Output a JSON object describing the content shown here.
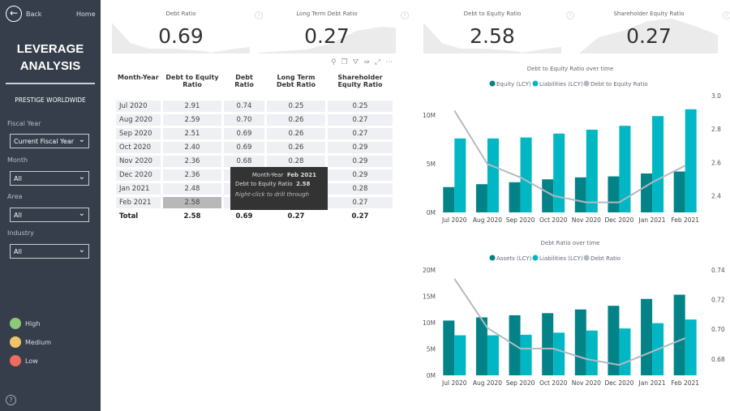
{
  "sidebar": {
    "back": "Back",
    "home": "Home",
    "title_line1": "LEVERAGE",
    "title_line2": "ANALYSIS",
    "company": "PRESTIGE WORLDWIDE",
    "filters": [
      {
        "label": "Fiscal Year",
        "value": "Current Fiscal Year"
      },
      {
        "label": "Month",
        "value": "All"
      },
      {
        "label": "Area",
        "value": "All"
      },
      {
        "label": "Industry",
        "value": "All"
      }
    ],
    "legend": [
      {
        "label": "High",
        "color": "#8cc97a"
      },
      {
        "label": "Medium",
        "color": "#f2c26b"
      },
      {
        "label": "Low",
        "color": "#ee6b5e"
      }
    ],
    "help": "?"
  },
  "kpis": [
    {
      "title": "Debt Ratio",
      "value": "0.69"
    },
    {
      "title": "Long Term Debt Ratio",
      "value": "0.27"
    },
    {
      "title": "Debt to Equity Ratio",
      "value": "2.58"
    },
    {
      "title": "Shareholder Equity Ratio",
      "value": "0.27"
    }
  ],
  "table": {
    "headers": [
      "Month-Year",
      "Debt to Equity Ratio",
      "Debt Ratio",
      "Long Term Debt Ratio",
      "Shareholder Equity Ratio"
    ],
    "rows": [
      [
        "Jul 2020",
        "2.91",
        "0.74",
        "0.25",
        "0.25"
      ],
      [
        "Aug 2020",
        "2.59",
        "0.70",
        "0.26",
        "0.27"
      ],
      [
        "Sep 2020",
        "2.51",
        "0.69",
        "0.26",
        "0.27"
      ],
      [
        "Oct 2020",
        "2.40",
        "0.69",
        "0.26",
        "0.29"
      ],
      [
        "Nov 2020",
        "2.36",
        "0.68",
        "0.28",
        "0.29"
      ],
      [
        "Dec 2020",
        "2.36",
        "",
        "",
        "0.29"
      ],
      [
        "Jan 2021",
        "2.48",
        "",
        "",
        "0.28"
      ],
      [
        "Feb 2021",
        "2.58",
        "",
        "",
        "0.27"
      ]
    ],
    "total": [
      "Total",
      "2.58",
      "0.69",
      "0.27",
      "0.27"
    ]
  },
  "tooltip": {
    "k1": "Month-Year",
    "v1": "Feb 2021",
    "k2": "Debt to Equity Ratio",
    "v2": "2.58",
    "hint": "Right-click to drill through"
  },
  "chart_data": [
    {
      "type": "bar",
      "title": "Debt to Equity Ratio over time",
      "categories": [
        "Jul 2020",
        "Aug 2020",
        "Sep 2020",
        "Oct 2020",
        "Nov 2020",
        "Dec 2020",
        "Jan 2021",
        "Feb 2021"
      ],
      "series": [
        {
          "name": "Equity (LCY)",
          "values": [
            2.6,
            2.9,
            3.1,
            3.4,
            3.6,
            3.7,
            4.0,
            4.2
          ],
          "color": "#038387"
        },
        {
          "name": "Liabilities (LCY)",
          "values": [
            7.6,
            7.6,
            7.7,
            8.1,
            8.5,
            8.9,
            9.9,
            10.6
          ],
          "color": "#00b7c3"
        },
        {
          "name": "Debt to Equity Ratio",
          "type": "line",
          "axis": "right",
          "values": [
            2.91,
            2.59,
            2.51,
            2.4,
            2.36,
            2.36,
            2.48,
            2.58
          ],
          "color": "#b3b9c4"
        }
      ],
      "ylim": [
        0,
        12
      ],
      "yticks": [
        "0M",
        "5M",
        "10M"
      ],
      "yticks_values": [
        0,
        5,
        10
      ],
      "y2lim": [
        2.3,
        3.0
      ],
      "y2ticks": [
        "2.4",
        "2.6",
        "2.8",
        "3.0"
      ],
      "y2ticks_values": [
        2.4,
        2.6,
        2.8,
        3.0
      ],
      "legend": "top"
    },
    {
      "type": "bar",
      "title": "Debt Ratio over time",
      "categories": [
        "Jul 2020",
        "Aug 2020",
        "Sep 2020",
        "Oct 2020",
        "Nov 2020",
        "Dec 2020",
        "Jan 2021",
        "Feb 2021"
      ],
      "series": [
        {
          "name": "Assets (LCY)",
          "values": [
            10.4,
            11.0,
            11.4,
            11.8,
            12.5,
            13.2,
            14.5,
            15.3
          ],
          "color": "#038387"
        },
        {
          "name": "Liabilities (LCY)",
          "values": [
            7.6,
            7.6,
            7.7,
            8.1,
            8.5,
            8.9,
            9.9,
            10.6
          ],
          "color": "#00b7c3"
        },
        {
          "name": "Debt Ratio",
          "type": "line",
          "axis": "right",
          "values": [
            0.734,
            0.701,
            0.687,
            0.687,
            0.68,
            0.676,
            0.685,
            0.694
          ],
          "color": "#b3b9c4"
        }
      ],
      "ylim": [
        0,
        20
      ],
      "yticks": [
        "0M",
        "5M",
        "10M",
        "15M",
        "20M"
      ],
      "yticks_values": [
        0,
        5,
        10,
        15,
        20
      ],
      "y2lim": [
        0.669,
        0.74
      ],
      "y2ticks": [
        "0.68",
        "0.70",
        "0.72",
        "0.74"
      ],
      "y2ticks_values": [
        0.68,
        0.7,
        0.72,
        0.74
      ],
      "legend": "top"
    }
  ]
}
